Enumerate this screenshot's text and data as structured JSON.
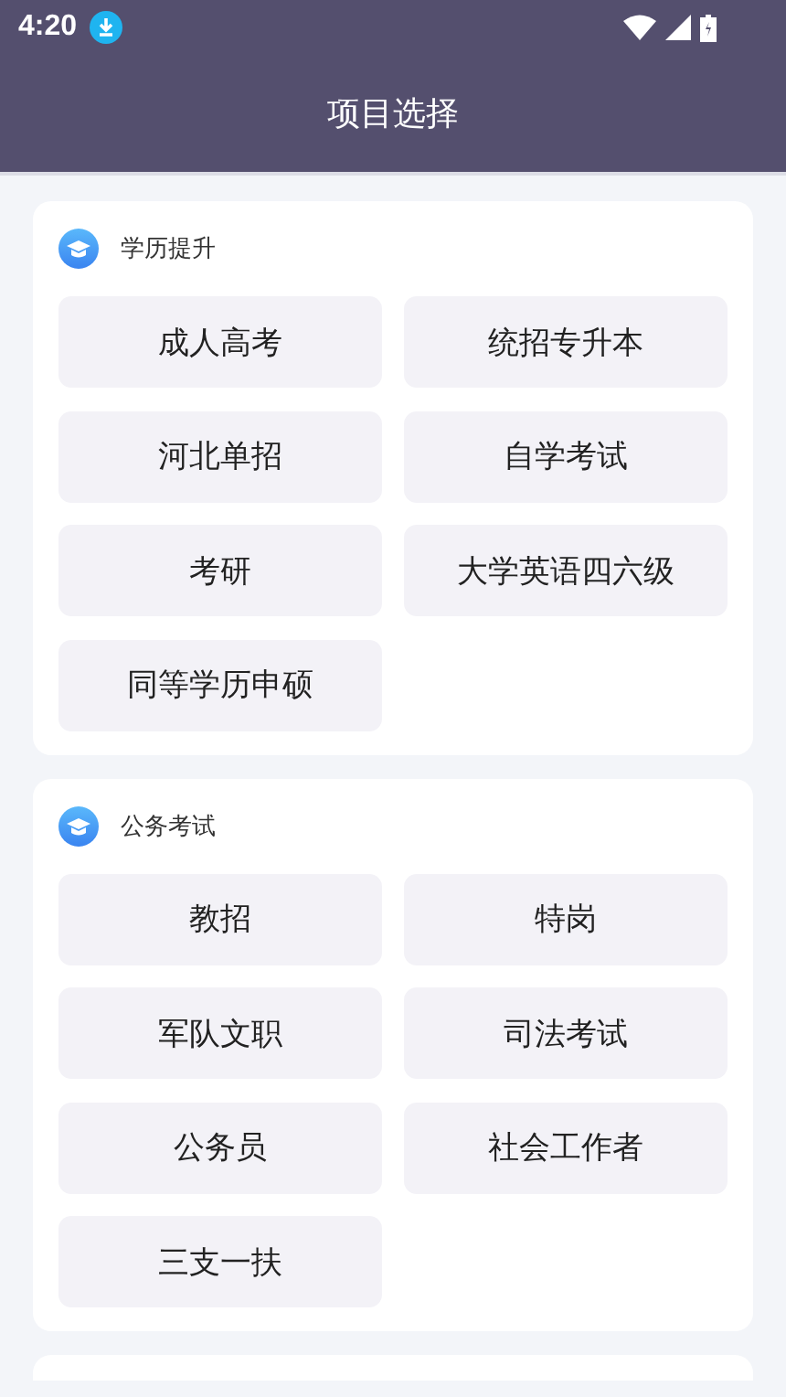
{
  "status_bar": {
    "time": "4:20"
  },
  "app_bar": {
    "title": "项目选择"
  },
  "sections": [
    {
      "title": "学历提升",
      "items": [
        "成人高考",
        "统招专升本",
        "河北单招",
        "自学考试",
        "考研",
        "大学英语四六级",
        "同等学历申硕"
      ]
    },
    {
      "title": "公务考试",
      "items": [
        "教招",
        "特岗",
        "军队文职",
        "司法考试",
        "公务员",
        "社会工作者",
        "三支一扶"
      ]
    }
  ]
}
